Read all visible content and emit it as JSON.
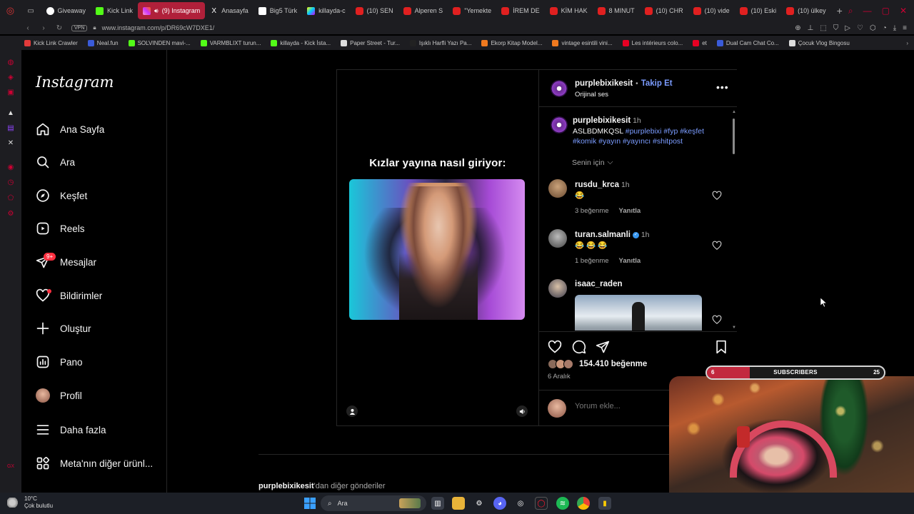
{
  "browser": {
    "tabs": [
      {
        "label": "Giveaway",
        "favicon": "giveaway-icon",
        "active": false
      },
      {
        "label": "Kick Link",
        "favicon": "kick-link-icon",
        "active": false
      },
      {
        "label": "(9) Instagram",
        "favicon": "instagram-icon",
        "active": true
      },
      {
        "label": "Anasayfa",
        "favicon": "x-icon",
        "active": false
      },
      {
        "label": "Big5 Türk",
        "favicon": "big5-icon",
        "active": false
      },
      {
        "label": "killayda-c",
        "favicon": "killayda-icon",
        "active": false
      },
      {
        "label": "(10) SEN",
        "favicon": "youtube-icon",
        "active": false
      },
      {
        "label": "Alperen S",
        "favicon": "youtube-icon",
        "active": false
      },
      {
        "label": "\"Yemekte",
        "favicon": "youtube-icon",
        "active": false
      },
      {
        "label": "İREM DE",
        "favicon": "youtube-icon",
        "active": false
      },
      {
        "label": "KİM HAK",
        "favicon": "youtube-icon",
        "active": false
      },
      {
        "label": "8 MINUT",
        "favicon": "youtube-icon",
        "active": false
      },
      {
        "label": "(10) CHR",
        "favicon": "youtube-icon",
        "active": false
      },
      {
        "label": "(10) vide",
        "favicon": "youtube-icon",
        "active": false
      },
      {
        "label": "(10) Eski",
        "favicon": "youtube-icon",
        "active": false
      },
      {
        "label": "(10) ülkey",
        "favicon": "youtube-icon",
        "active": false
      }
    ],
    "vpn_label": "VPN",
    "url": "www.instagram.com/p/DR69cW7DXE1/",
    "bookmarks": [
      {
        "label": "Kick Link Crawler",
        "color": "#e23b3b"
      },
      {
        "label": "Neal.fun",
        "color": "#3a5bd9"
      },
      {
        "label": "SOLVINDEN mavi-...",
        "color": "#53fc18"
      },
      {
        "label": "VARMBLIXT turun...",
        "color": "#53fc18"
      },
      {
        "label": "killayda - Kick İsta...",
        "color": "#53fc18"
      },
      {
        "label": "Paper Street - Tur...",
        "color": "#dddddd"
      },
      {
        "label": "Işıklı Harfli Yazı Pa...",
        "color": "#222222"
      },
      {
        "label": "Ekorp Kitap Model...",
        "color": "#f07a1f"
      },
      {
        "label": "vintage esintili vini...",
        "color": "#f07a1f"
      },
      {
        "label": "Les intérieurs colo...",
        "color": "#e60023"
      },
      {
        "label": "et",
        "color": "#e60023"
      },
      {
        "label": "Dual Cam Chat Co...",
        "color": "#3a5bd9"
      },
      {
        "label": "Çocuk Vlog Bingosu",
        "color": "#dddddd"
      }
    ]
  },
  "sidebar": {
    "logo": "Instagram",
    "items": [
      {
        "label": "Ana Sayfa",
        "icon": "home-icon"
      },
      {
        "label": "Ara",
        "icon": "search-icon"
      },
      {
        "label": "Keşfet",
        "icon": "compass-icon"
      },
      {
        "label": "Reels",
        "icon": "reels-icon"
      },
      {
        "label": "Mesajlar",
        "icon": "messenger-icon",
        "badge": "9+"
      },
      {
        "label": "Bildirimler",
        "icon": "heart-icon"
      },
      {
        "label": "Oluştur",
        "icon": "plus-icon"
      },
      {
        "label": "Pano",
        "icon": "dashboard-icon"
      },
      {
        "label": "Profil",
        "icon": "avatar"
      },
      {
        "label": "Daha fazla",
        "icon": "menu-icon"
      },
      {
        "label": "Meta'nın diğer ürünl...",
        "icon": "meta-apps-icon"
      }
    ]
  },
  "post": {
    "media_caption": "Kızlar yayına nasıl giriyor:",
    "author": "purplebixikesit",
    "separator": "•",
    "follow_label": "Takip Et",
    "audio": "Orijinal ses",
    "caption": {
      "username": "purplebixikesit",
      "time": "1h",
      "text": "ASLBDMKQSL",
      "hashtags_line1": "#purplebixi #fyp #keşfet",
      "hashtags_line2": "#komik #yayın #yayıncı #shitpost"
    },
    "sort_label": "Senin için",
    "comments": [
      {
        "username": "rusdu_krca",
        "time": "1h",
        "text": "😂",
        "likes": "3 beğenme",
        "reply": "Yanıtla",
        "verified": false
      },
      {
        "username": "turan.salmanli",
        "time": "1h",
        "text": "😂 😂 😂",
        "likes": "1 beğenme",
        "reply": "Yanıtla",
        "verified": true
      },
      {
        "username": "isaac_raden",
        "time": "",
        "text": "",
        "likes": "",
        "reply": "",
        "verified": false
      }
    ],
    "likes_count": "154.410 beğenme",
    "date": "6 Aralık",
    "comment_placeholder": "Yorum ekle..."
  },
  "more_posts": {
    "username": "purplebixikesit",
    "suffix": "'dan diğer gönderiler"
  },
  "overlay": {
    "sub_left": "6",
    "sub_label": "SUBSCRIBERS",
    "sub_right": "25",
    "sub_progress": 0.24
  },
  "taskbar": {
    "temperature": "10°C",
    "weather": "Çok bulutlu",
    "search_label": "Ara"
  }
}
